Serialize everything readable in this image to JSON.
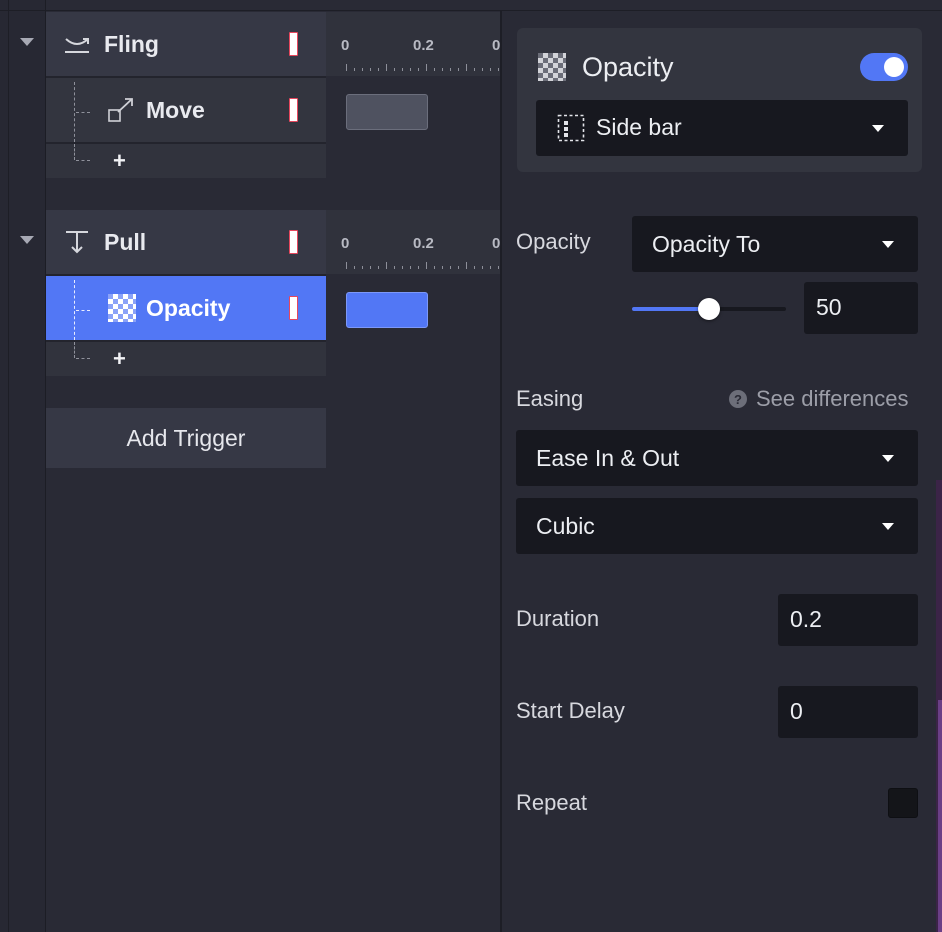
{
  "timeline": {
    "triggers": [
      {
        "label": "Fling",
        "icon": "fling-icon",
        "ruler": [
          "0",
          "0.2",
          "0"
        ],
        "animations": [
          {
            "label": "Move",
            "icon": "move-icon",
            "selected": false
          }
        ],
        "add_symbol": "+"
      },
      {
        "label": "Pull",
        "icon": "pull-icon",
        "ruler": [
          "0",
          "0.2",
          "0"
        ],
        "animations": [
          {
            "label": "Opacity",
            "icon": "opacity-checker-icon",
            "selected": true
          }
        ],
        "add_symbol": "+"
      }
    ],
    "add_trigger_label": "Add Trigger"
  },
  "properties": {
    "header": {
      "title": "Opacity",
      "enabled": true,
      "target": "Side bar"
    },
    "opacity": {
      "label": "Opacity",
      "mode": "Opacity To",
      "value": "50",
      "slider_percent": 50
    },
    "easing": {
      "label": "Easing",
      "help_symbol": "?",
      "link": "See differences",
      "curve": "Ease In & Out",
      "type": "Cubic"
    },
    "duration": {
      "label": "Duration",
      "value": "0.2"
    },
    "start_delay": {
      "label": "Start Delay",
      "value": "0"
    },
    "repeat": {
      "label": "Repeat",
      "checked": false
    }
  },
  "colors": {
    "accent": "#5277f5",
    "background": "#292a35",
    "input_bg": "#17181f"
  }
}
